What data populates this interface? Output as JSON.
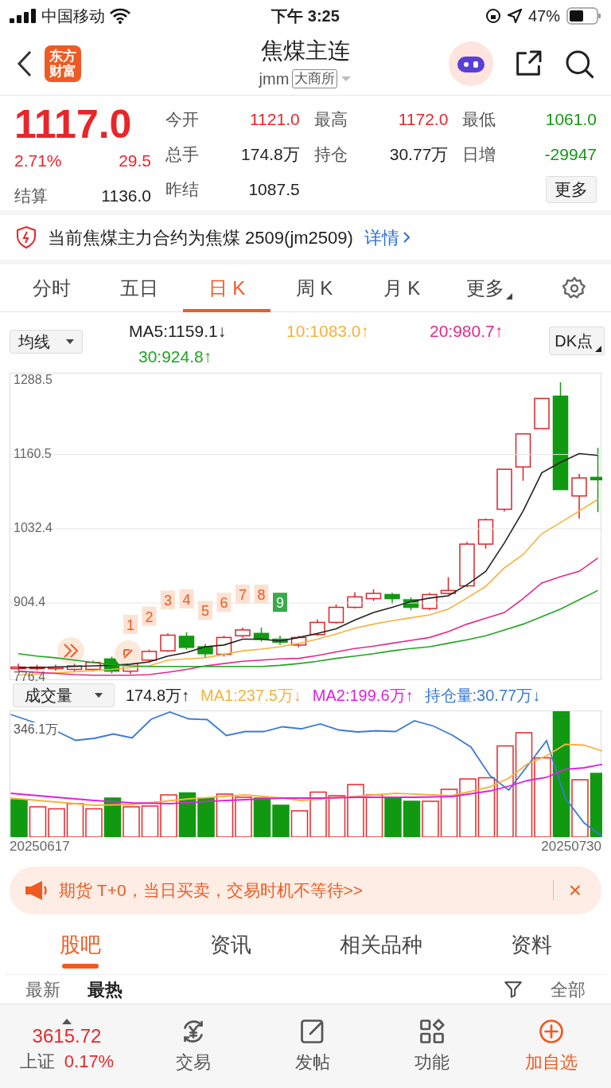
{
  "status_bar": {
    "carrier": "中国移动",
    "time": "下午 3:25",
    "battery": "47%"
  },
  "nav": {
    "logo": [
      "东方",
      "财富"
    ],
    "title": "焦煤主连",
    "code": "jmm",
    "exchange": "大商所"
  },
  "quote": {
    "price": "1117.0",
    "change_pct": "2.71%",
    "change": "29.5",
    "color": "#e8262a",
    "settle_label": "结算",
    "settle": "1136.0",
    "stats": [
      {
        "label": "今开",
        "value": "1121.0",
        "color": "#e8262a"
      },
      {
        "label": "最高",
        "value": "1172.0",
        "color": "#e8262a"
      },
      {
        "label": "最低",
        "value": "1061.0",
        "color": "#119a11"
      },
      {
        "label": "总手",
        "value": "174.8万",
        "color": "#222222"
      },
      {
        "label": "持仓",
        "value": "30.77万",
        "color": "#222222"
      },
      {
        "label": "日增",
        "value": "-29947",
        "color": "#119a11"
      },
      {
        "label": "昨结",
        "value": "1087.5",
        "color": "#222222"
      }
    ],
    "more_button": "更多"
  },
  "notice": {
    "text": "当前焦煤主力合约为焦煤 2509(jm2509)",
    "link": "详情"
  },
  "period_tabs": [
    {
      "label": "分时",
      "selected": false
    },
    {
      "label": "五日",
      "selected": false
    },
    {
      "label": "日 K",
      "selected": true
    },
    {
      "label": "周 K",
      "selected": false
    },
    {
      "label": "月 K",
      "selected": false
    },
    {
      "label": "更多",
      "selected": false
    }
  ],
  "ma_legend": {
    "selector": "均线",
    "readings": [
      ":1159.1↓",
      ":1083.0↑",
      ":980.7↑",
      ":924.8↑"
    ],
    "dk_button": "DK点"
  },
  "kline": {
    "chart_data": {
      "type": "line",
      "ylim": [
        770,
        1300
      ],
      "yticks": [
        1288.5,
        1160.5,
        1032.4,
        904.4,
        776.4
      ],
      "series": [
        {
          "name": "MA5",
          "color": "#222222",
          "values": [
            793,
            793,
            794,
            795,
            796,
            797,
            799,
            803,
            813,
            819,
            829,
            832,
            842,
            842,
            839,
            845,
            852,
            860,
            875,
            888,
            897,
            907,
            913,
            917,
            936,
            959,
            1008,
            1063,
            1129,
            1147,
            1162,
            1159
          ]
        },
        {
          "name": "10",
          "color": "#f7b23b",
          "values": [
            780,
            782,
            784,
            786,
            788,
            790,
            793,
            796,
            806,
            808,
            810,
            816,
            822,
            825,
            829,
            835,
            842,
            851,
            861,
            868,
            874,
            879,
            884,
            894,
            913,
            933,
            965,
            988,
            1024,
            1043,
            1063,
            1083
          ]
        },
        {
          "name": "20",
          "color": "#e4288c",
          "values": [
            787,
            785,
            783,
            781,
            780,
            780,
            780,
            781,
            785,
            790,
            796,
            800,
            804,
            806,
            808,
            809,
            814,
            820,
            826,
            830,
            835,
            840,
            845,
            855,
            868,
            878,
            888,
            912,
            939,
            950,
            959,
            982
          ]
        },
        {
          "name": "30",
          "color": "#1fa51f",
          "values": [
            817,
            813,
            810,
            806,
            802,
            798,
            796,
            795,
            795,
            795,
            795,
            795,
            795,
            795,
            797,
            800,
            804,
            809,
            813,
            817,
            822,
            826,
            829,
            835,
            841,
            848,
            858,
            868,
            881,
            894,
            910,
            926
          ]
        }
      ],
      "grid": true,
      "annotations": [
        "1",
        "2",
        "3",
        "4",
        "5",
        "6",
        "7",
        "8",
        "9"
      ]
    }
  },
  "volume_legend": {
    "selector": "成交量",
    "items": [
      {
        "text": "174.8万↑",
        "color": "#222222"
      },
      {
        "text": "MA1:237.5万↓",
        "color": "#f7b23b"
      },
      {
        "text": "MA2:199.6万↑",
        "color": "#e020e0"
      },
      {
        "text": "持仓量:30.77万↓",
        "color": "#3a7bd5"
      }
    ]
  },
  "volume": {
    "top_label": "346.1万",
    "start_date": "20250617",
    "end_date": "20250730"
  },
  "promo": {
    "text": "期货 T+0，当日买卖，交易时机不等待>>",
    "close": "×"
  },
  "content_tabs": [
    {
      "label": "股吧",
      "selected": true
    },
    {
      "label": "资讯",
      "selected": false
    },
    {
      "label": "相关品种",
      "selected": false
    },
    {
      "label": "资料",
      "selected": false
    }
  ],
  "sort_tabs": [
    {
      "label": "最新",
      "selected": false
    },
    {
      "label": "最热",
      "selected": true
    }
  ],
  "filter": "全部",
  "bottom_bar": {
    "index_value": "3615.72",
    "index_name": "上证",
    "index_change": "0.17%",
    "items": [
      {
        "label": "交易",
        "kind": "trade"
      },
      {
        "label": "发帖",
        "kind": "post"
      },
      {
        "label": "功能",
        "kind": "functions"
      },
      {
        "label": "加自选",
        "kind": "add"
      }
    ]
  }
}
